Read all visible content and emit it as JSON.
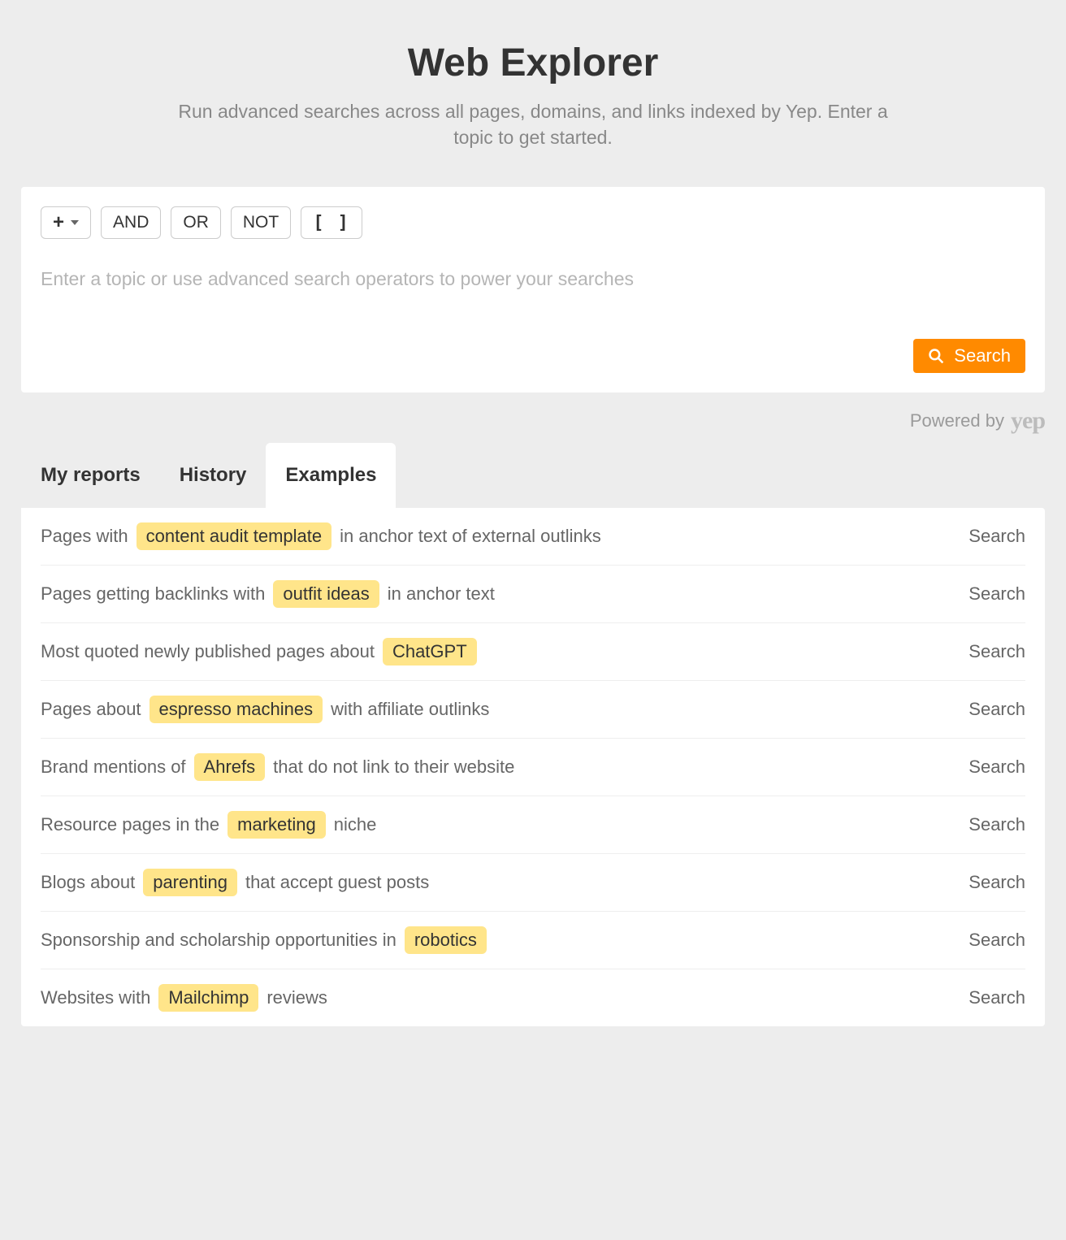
{
  "header": {
    "title": "Web Explorer",
    "subtitle": "Run advanced searches across all pages, domains, and links indexed by Yep. Enter a topic to get started."
  },
  "operators": {
    "and": "AND",
    "or": "OR",
    "not": "NOT",
    "brackets": "[ ]"
  },
  "search": {
    "placeholder": "Enter a topic or use advanced search operators to power your searches",
    "button": "Search"
  },
  "powered": {
    "prefix": "Powered by",
    "brand": "yep"
  },
  "tabs": {
    "my_reports": "My reports",
    "history": "History",
    "examples": "Examples"
  },
  "examples": [
    {
      "pre": "Pages with",
      "chip": "content audit template",
      "post": "in anchor text of external outlinks",
      "action": "Search"
    },
    {
      "pre": "Pages getting backlinks with",
      "chip": "outfit ideas",
      "post": "in anchor text",
      "action": "Search"
    },
    {
      "pre": "Most quoted newly published pages about",
      "chip": "ChatGPT",
      "post": "",
      "action": "Search"
    },
    {
      "pre": "Pages about",
      "chip": "espresso machines",
      "post": "with affiliate outlinks",
      "action": "Search"
    },
    {
      "pre": "Brand mentions of",
      "chip": "Ahrefs",
      "post": "that do not link to their website",
      "action": "Search"
    },
    {
      "pre": "Resource pages in the",
      "chip": "marketing",
      "post": "niche",
      "action": "Search"
    },
    {
      "pre": "Blogs about",
      "chip": "parenting",
      "post": "that accept guest posts",
      "action": "Search"
    },
    {
      "pre": "Sponsorship and scholarship opportunities in",
      "chip": "robotics",
      "post": "",
      "action": "Search"
    },
    {
      "pre": "Websites with",
      "chip": "Mailchimp",
      "post": "reviews",
      "action": "Search"
    }
  ]
}
